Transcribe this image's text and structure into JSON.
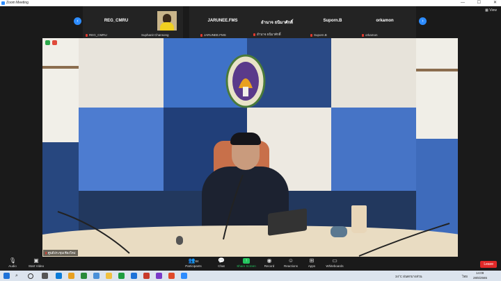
{
  "window": {
    "title": "Zoom Meeting",
    "controls": [
      "—",
      "☐",
      "✕"
    ]
  },
  "gallery": {
    "view_label": "View",
    "tiles": [
      {
        "name": "REG_CMRU",
        "tag": "REG_CMRU"
      },
      {
        "name": "",
        "tag": "Suphanit Chansong",
        "has_video": true
      },
      {
        "name": "JARUNEE.FMS",
        "tag": "JARUNEE.FMS"
      },
      {
        "name": "อำนาจ ธนิมาศักดิ์",
        "tag": "อำนาจ ธนิมาศักดิ์"
      },
      {
        "name": "Suporn.B",
        "tag": "Suporn.B"
      },
      {
        "name": "orkamon",
        "tag": "orkamon"
      }
    ]
  },
  "main_video": {
    "speaker_label": "ศูนย์ประชุมเชียงใหม่"
  },
  "controls": {
    "audio": "Audio",
    "video": "Start Video",
    "participants": "Participants",
    "participants_count": "84",
    "chat": "Chat",
    "chat_badge": "1",
    "share": "Share Screen",
    "record": "Record",
    "reactions": "Reactions",
    "apps": "Apps",
    "whiteboards": "Whiteboards",
    "leave": "Leave"
  },
  "taskbar": {
    "weather": "34°C ฝนตกบางส่วน",
    "lang": "ไทย",
    "time": "14:09",
    "date": "28/6/2565"
  },
  "colors": {
    "accent": "#2d8cff",
    "leave": "#e02828",
    "mute": "#e0392e",
    "share": "#23c55e"
  }
}
